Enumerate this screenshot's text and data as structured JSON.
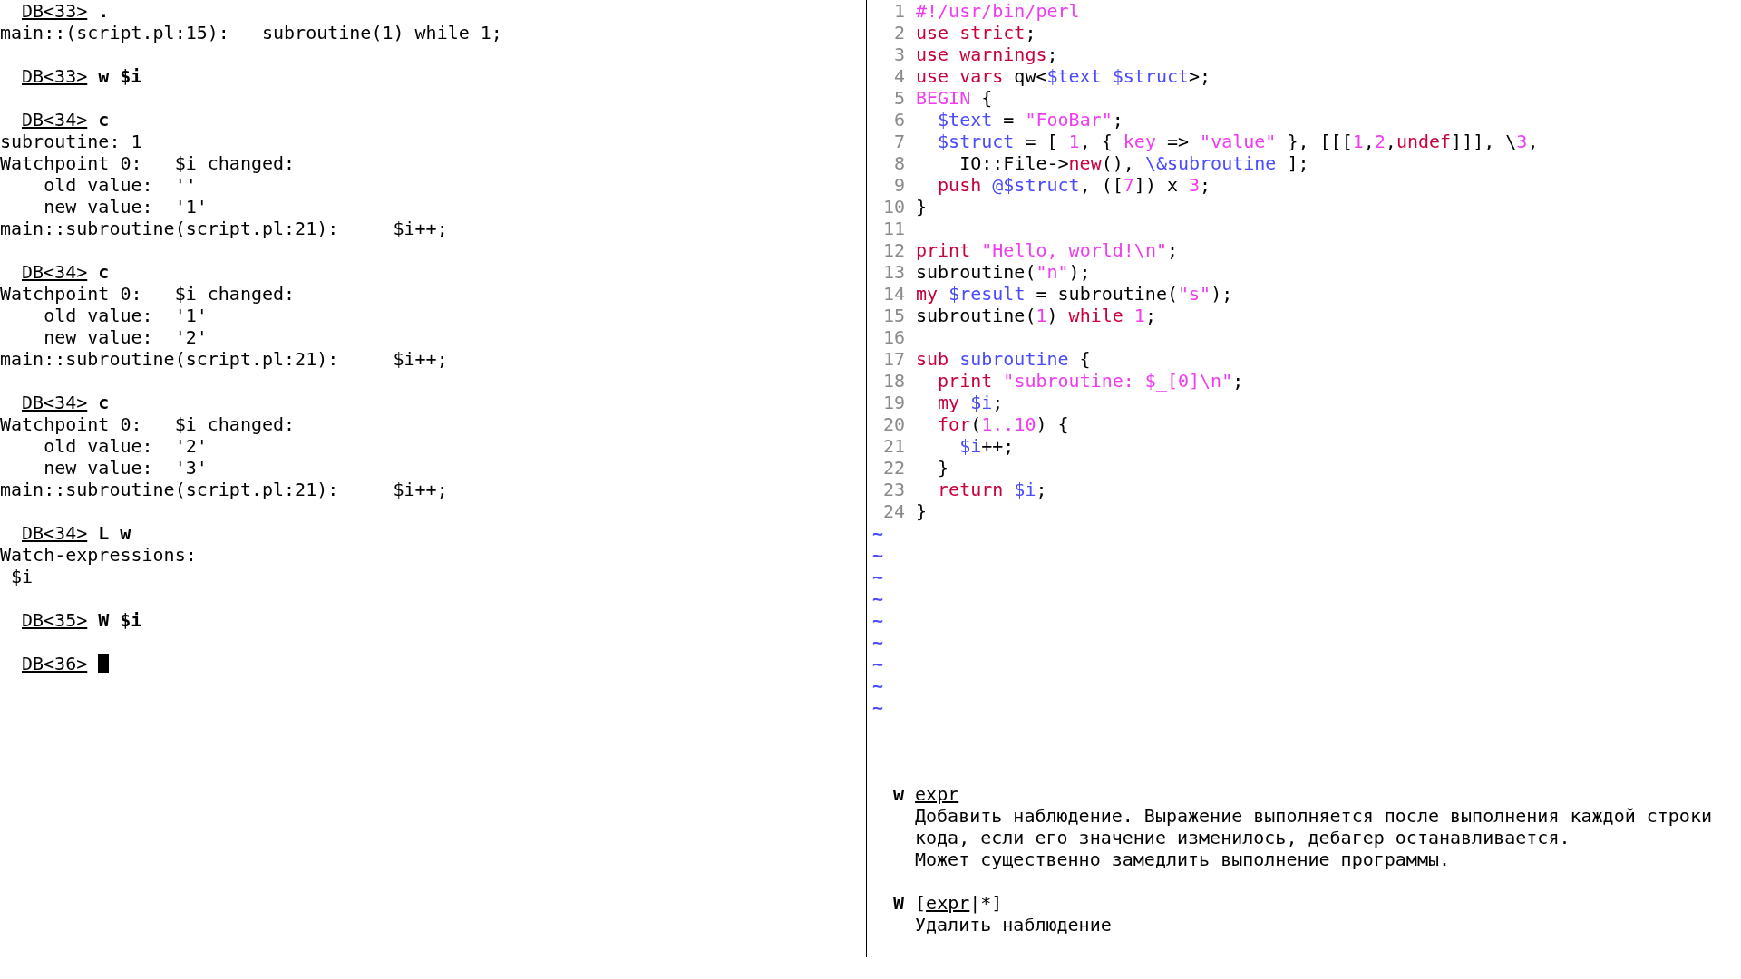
{
  "debugger": {
    "lines": [
      {
        "kind": "prompt",
        "prompt": "DB<33>",
        "command": "."
      },
      {
        "kind": "output",
        "text": "main::(script.pl:15):   subroutine(1) while 1;"
      },
      {
        "kind": "blank"
      },
      {
        "kind": "prompt",
        "prompt": "DB<33>",
        "command": "w $i"
      },
      {
        "kind": "blank"
      },
      {
        "kind": "prompt",
        "prompt": "DB<34>",
        "command": "c"
      },
      {
        "kind": "output",
        "text": "subroutine: 1"
      },
      {
        "kind": "output",
        "text": "Watchpoint 0:   $i changed:"
      },
      {
        "kind": "output",
        "text": "    old value:  ''"
      },
      {
        "kind": "output",
        "text": "    new value:  '1'"
      },
      {
        "kind": "output",
        "text": "main::subroutine(script.pl:21):     $i++;"
      },
      {
        "kind": "blank"
      },
      {
        "kind": "prompt",
        "prompt": "DB<34>",
        "command": "c"
      },
      {
        "kind": "output",
        "text": "Watchpoint 0:   $i changed:"
      },
      {
        "kind": "output",
        "text": "    old value:  '1'"
      },
      {
        "kind": "output",
        "text": "    new value:  '2'"
      },
      {
        "kind": "output",
        "text": "main::subroutine(script.pl:21):     $i++;"
      },
      {
        "kind": "blank"
      },
      {
        "kind": "prompt",
        "prompt": "DB<34>",
        "command": "c"
      },
      {
        "kind": "output",
        "text": "Watchpoint 0:   $i changed:"
      },
      {
        "kind": "output",
        "text": "    old value:  '2'"
      },
      {
        "kind": "output",
        "text": "    new value:  '3'"
      },
      {
        "kind": "output",
        "text": "main::subroutine(script.pl:21):     $i++;"
      },
      {
        "kind": "blank"
      },
      {
        "kind": "prompt",
        "prompt": "DB<34>",
        "command": "L w"
      },
      {
        "kind": "output",
        "text": "Watch-expressions:"
      },
      {
        "kind": "output",
        "text": " $i"
      },
      {
        "kind": "blank"
      },
      {
        "kind": "prompt",
        "prompt": "DB<35>",
        "command": "W $i"
      },
      {
        "kind": "blank"
      },
      {
        "kind": "prompt",
        "prompt": "DB<36>",
        "cursor": true
      }
    ]
  },
  "editor": {
    "lines": [
      {
        "number": "1",
        "segments": [
          {
            "kind": "constant",
            "text": "#!/usr/bin/perl"
          }
        ]
      },
      {
        "number": "2",
        "segments": [
          {
            "kind": "statement",
            "text": "use strict"
          },
          {
            "kind": "plain",
            "text": ";"
          }
        ]
      },
      {
        "number": "3",
        "segments": [
          {
            "kind": "statement",
            "text": "use warnings"
          },
          {
            "kind": "plain",
            "text": ";"
          }
        ]
      },
      {
        "number": "4",
        "segments": [
          {
            "kind": "statement",
            "text": "use vars"
          },
          {
            "kind": "plain",
            "text": " qw<"
          },
          {
            "kind": "identifier",
            "text": "$text $struct"
          },
          {
            "kind": "plain",
            "text": ">;"
          }
        ]
      },
      {
        "number": "5",
        "segments": [
          {
            "kind": "constant",
            "text": "BEGIN"
          },
          {
            "kind": "plain",
            "text": " {"
          }
        ]
      },
      {
        "number": "6",
        "segments": [
          {
            "kind": "identifier",
            "text": "  $text"
          },
          {
            "kind": "plain",
            "text": " = "
          },
          {
            "kind": "constant",
            "text": "\"FooBar\""
          },
          {
            "kind": "plain",
            "text": ";"
          }
        ]
      },
      {
        "number": "7",
        "segments": [
          {
            "kind": "identifier",
            "text": "  $struct"
          },
          {
            "kind": "plain",
            "text": " = [ "
          },
          {
            "kind": "constant",
            "text": "1"
          },
          {
            "kind": "plain",
            "text": ", { "
          },
          {
            "kind": "constant",
            "text": "key"
          },
          {
            "kind": "plain",
            "text": " => "
          },
          {
            "kind": "constant",
            "text": "\"value\""
          },
          {
            "kind": "plain",
            "text": " }, [[["
          },
          {
            "kind": "constant",
            "text": "1"
          },
          {
            "kind": "plain",
            "text": ","
          },
          {
            "kind": "constant",
            "text": "2"
          },
          {
            "kind": "plain",
            "text": ","
          },
          {
            "kind": "statement",
            "text": "undef"
          },
          {
            "kind": "plain",
            "text": "]]], \\"
          },
          {
            "kind": "constant",
            "text": "3"
          },
          {
            "kind": "plain",
            "text": ","
          }
        ]
      },
      {
        "number": "8",
        "segments": [
          {
            "kind": "plain",
            "text": "    IO::File->"
          },
          {
            "kind": "statement",
            "text": "new"
          },
          {
            "kind": "plain",
            "text": "(), "
          },
          {
            "kind": "identifier",
            "text": "\\&subroutine"
          },
          {
            "kind": "plain",
            "text": " ];"
          }
        ]
      },
      {
        "number": "9",
        "segments": [
          {
            "kind": "statement",
            "text": "  push"
          },
          {
            "kind": "identifier",
            "text": " @$struct"
          },
          {
            "kind": "plain",
            "text": ", (["
          },
          {
            "kind": "constant",
            "text": "7"
          },
          {
            "kind": "plain",
            "text": "]) x "
          },
          {
            "kind": "constant",
            "text": "3"
          },
          {
            "kind": "plain",
            "text": ";"
          }
        ]
      },
      {
        "number": "10",
        "segments": [
          {
            "kind": "plain",
            "text": "}"
          }
        ]
      },
      {
        "number": "11"
      },
      {
        "number": "12",
        "segments": [
          {
            "kind": "statement",
            "text": "print"
          },
          {
            "kind": "constant",
            "text": " \"Hello, world!\\n\""
          },
          {
            "kind": "plain",
            "text": ";"
          }
        ]
      },
      {
        "number": "13",
        "segments": [
          {
            "kind": "plain",
            "text": "subroutine("
          },
          {
            "kind": "constant",
            "text": "\"n\""
          },
          {
            "kind": "plain",
            "text": ");"
          }
        ]
      },
      {
        "number": "14",
        "segments": [
          {
            "kind": "statement",
            "text": "my"
          },
          {
            "kind": "identifier",
            "text": " $result"
          },
          {
            "kind": "plain",
            "text": " = subroutine("
          },
          {
            "kind": "constant",
            "text": "\"s\""
          },
          {
            "kind": "plain",
            "text": ");"
          }
        ]
      },
      {
        "number": "15",
        "segments": [
          {
            "kind": "plain",
            "text": "subroutine("
          },
          {
            "kind": "constant",
            "text": "1"
          },
          {
            "kind": "plain",
            "text": ") "
          },
          {
            "kind": "statement",
            "text": "while"
          },
          {
            "kind": "constant",
            "text": " 1"
          },
          {
            "kind": "plain",
            "text": ";"
          }
        ]
      },
      {
        "number": "16"
      },
      {
        "number": "17",
        "segments": [
          {
            "kind": "statement",
            "text": "sub"
          },
          {
            "kind": "identifier",
            "text": " subroutine"
          },
          {
            "kind": "plain",
            "text": " {"
          }
        ]
      },
      {
        "number": "18",
        "segments": [
          {
            "kind": "statement",
            "text": "  print"
          },
          {
            "kind": "constant",
            "text": " \"subroutine: $_[0]\\n\""
          },
          {
            "kind": "plain",
            "text": ";"
          }
        ]
      },
      {
        "number": "19",
        "segments": [
          {
            "kind": "statement",
            "text": "  my"
          },
          {
            "kind": "identifier",
            "text": " $i"
          },
          {
            "kind": "plain",
            "text": ";"
          }
        ]
      },
      {
        "number": "20",
        "segments": [
          {
            "kind": "statement",
            "text": "  for"
          },
          {
            "kind": "plain",
            "text": "("
          },
          {
            "kind": "constant",
            "text": "1..10"
          },
          {
            "kind": "plain",
            "text": ") {"
          }
        ]
      },
      {
        "number": "21",
        "segments": [
          {
            "kind": "identifier",
            "text": "    $i"
          },
          {
            "kind": "plain",
            "text": "++;"
          }
        ]
      },
      {
        "number": "22",
        "segments": [
          {
            "kind": "plain",
            "text": "  }"
          }
        ]
      },
      {
        "number": "23",
        "segments": [
          {
            "kind": "statement",
            "text": "  return"
          },
          {
            "kind": "identifier",
            "text": " $i"
          },
          {
            "kind": "plain",
            "text": ";"
          }
        ]
      },
      {
        "number": "24",
        "segments": [
          {
            "kind": "plain",
            "text": "}"
          }
        ]
      }
    ],
    "tildes": [
      "~",
      "~",
      "~",
      "~",
      "~",
      "~",
      "~",
      "~",
      "~"
    ]
  },
  "help": {
    "entries": [
      {
        "command": "w",
        "syntax": [
          {
            "text": "expr",
            "underlined": true
          }
        ],
        "description": [
          "Добавить наблюдение. Выражение выполняется после выполнения каждой строки",
          "кода, если его значение изменилось, дебагер останавливается.",
          "Может существенно замедлить выполнение программы."
        ]
      },
      {
        "command": "W",
        "syntax": [
          {
            "text": "[",
            "underlined": false
          },
          {
            "text": "expr",
            "underlined": true
          },
          {
            "text": "|*]",
            "underlined": false
          }
        ],
        "description": [
          "Удалить наблюдение"
        ]
      }
    ]
  }
}
